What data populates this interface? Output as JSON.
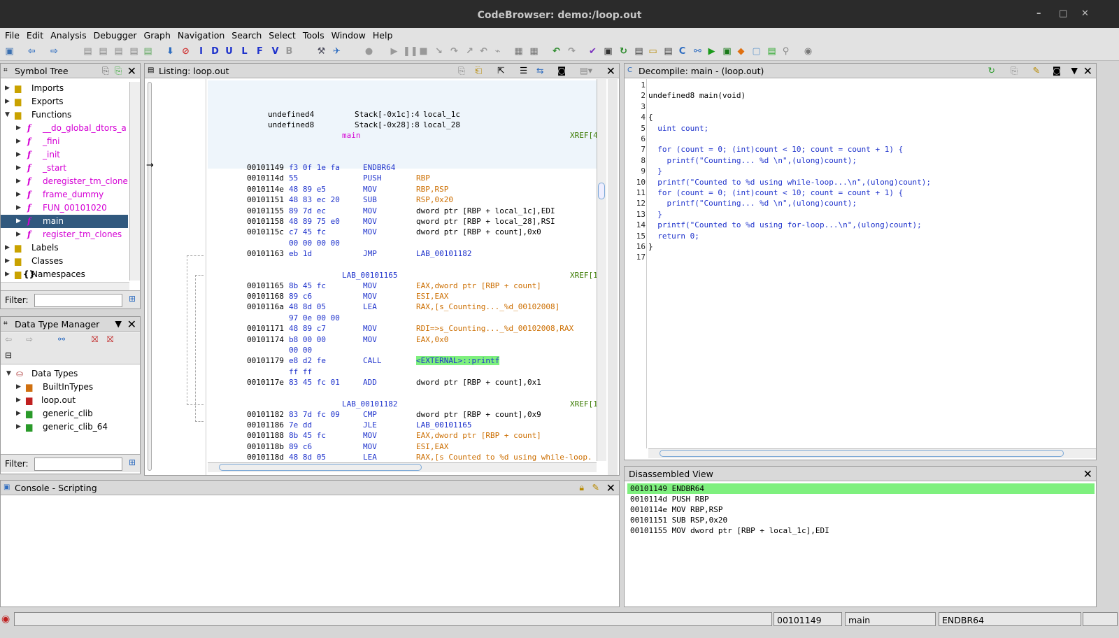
{
  "window": {
    "title": "CodeBrowser: demo:/loop.out",
    "controls": [
      "–",
      "□",
      "✕"
    ]
  },
  "menu": [
    "File",
    "Edit",
    "Analysis",
    "Debugger",
    "Graph",
    "Navigation",
    "Search",
    "Select",
    "Tools",
    "Window",
    "Help"
  ],
  "symbol_tree": {
    "title": "Symbol Tree",
    "items": [
      {
        "label": "Imports"
      },
      {
        "label": "Exports"
      },
      {
        "label": "Functions"
      },
      {
        "label": "__do_global_dtors_a"
      },
      {
        "label": "_fini"
      },
      {
        "label": "_init"
      },
      {
        "label": "_start"
      },
      {
        "label": "deregister_tm_clone"
      },
      {
        "label": "frame_dummy"
      },
      {
        "label": "FUN_00101020"
      },
      {
        "label": "main"
      },
      {
        "label": "register_tm_clones"
      },
      {
        "label": "Labels"
      },
      {
        "label": "Classes"
      },
      {
        "label": "Namespaces"
      }
    ],
    "filter_label": "Filter:"
  },
  "dtm": {
    "title": "Data Type Manager",
    "items": [
      {
        "label": "Data Types"
      },
      {
        "label": "BuiltInTypes"
      },
      {
        "label": "loop.out"
      },
      {
        "label": "generic_clib"
      },
      {
        "label": "generic_clib_64"
      }
    ],
    "filter_label": "Filter:"
  },
  "listing": {
    "title": "Listing:  loop.out",
    "header": [
      {
        "type": "undefined4",
        "stack": "Stack[-0x1c]:4",
        "name": "local_1c"
      },
      {
        "type": "undefined8",
        "stack": "Stack[-0x28]:8",
        "name": "local_28"
      }
    ],
    "func_label": "main",
    "xref": "XREF[4",
    "rows": [
      {
        "a": "00101149",
        "b": "f3 0f 1e fa",
        "m": "ENDBR64",
        "o": ""
      },
      {
        "a": "0010114d",
        "b": "55",
        "m": "PUSH",
        "o": "RBP"
      },
      {
        "a": "0010114e",
        "b": "48 89 e5",
        "m": "MOV",
        "o": "RBP,RSP"
      },
      {
        "a": "00101151",
        "b": "48 83 ec 20",
        "m": "SUB",
        "o": "RSP,0x20"
      },
      {
        "a": "00101155",
        "b": "89 7d ec",
        "m": "MOV",
        "o": "dword ptr [RBP + local_1c],EDI"
      },
      {
        "a": "00101158",
        "b": "48 89 75 e0",
        "m": "MOV",
        "o": "qword ptr [RBP + local_28],RSI"
      },
      {
        "a": "0010115c",
        "b": "c7 45 fc",
        "m": "MOV",
        "o": "dword ptr [RBP + count],0x0"
      },
      {
        "a": "",
        "b": "00 00 00 00",
        "m": "",
        "o": ""
      },
      {
        "a": "00101163",
        "b": "eb 1d",
        "m": "JMP",
        "o": "LAB_00101182"
      },
      {
        "a": "",
        "b": "",
        "m": "",
        "o": ""
      },
      {
        "a": "00101165",
        "b": "8b 45 fc",
        "m": "MOV",
        "o": "EAX,dword ptr [RBP + count]"
      },
      {
        "a": "00101168",
        "b": "89 c6",
        "m": "MOV",
        "o": "ESI,EAX"
      },
      {
        "a": "0010116a",
        "b": "48 8d 05",
        "m": "LEA",
        "o": "RAX,[s_Counting..._%d_00102008]"
      },
      {
        "a": "",
        "b": "97 0e 00 00",
        "m": "",
        "o": ""
      },
      {
        "a": "00101171",
        "b": "48 89 c7",
        "m": "MOV",
        "o": "RDI=>s_Counting..._%d_00102008,RAX"
      },
      {
        "a": "00101174",
        "b": "b8 00 00",
        "m": "MOV",
        "o": "EAX,0x0"
      },
      {
        "a": "",
        "b": "00 00",
        "m": "",
        "o": ""
      },
      {
        "a": "00101179",
        "b": "e8 d2 fe",
        "m": "CALL",
        "o": "<EXTERNAL>::printf"
      },
      {
        "a": "",
        "b": "ff ff",
        "m": "",
        "o": ""
      },
      {
        "a": "0010117e",
        "b": "83 45 fc 01",
        "m": "ADD",
        "o": "dword ptr [RBP + count],0x1"
      },
      {
        "a": "",
        "b": "",
        "m": "",
        "o": ""
      },
      {
        "a": "00101182",
        "b": "83 7d fc 09",
        "m": "CMP",
        "o": "dword ptr [RBP + count],0x9"
      },
      {
        "a": "00101186",
        "b": "7e dd",
        "m": "JLE",
        "o": "LAB_00101165"
      },
      {
        "a": "00101188",
        "b": "8b 45 fc",
        "m": "MOV",
        "o": "EAX,dword ptr [RBP + count]"
      },
      {
        "a": "0010118b",
        "b": "89 c6",
        "m": "MOV",
        "o": "ESI,EAX"
      },
      {
        "a": "0010118d",
        "b": "48 8d 05",
        "m": "LEA",
        "o": "RAX,[s_Counted_to_%d_using_while-loop."
      }
    ],
    "labels": [
      {
        "text": "LAB_00101165",
        "xref": "XREF[1"
      },
      {
        "text": "LAB_00101182",
        "xref": "XREF[1"
      }
    ]
  },
  "decompile": {
    "title": "Decompile: main -  (loop.out)",
    "lines": [
      "",
      "undefined8 main(void)",
      "",
      "{",
      "  uint count;",
      "",
      "  for (count = 0; (int)count < 10; count = count + 1) {",
      "    printf(\"Counting... %d \\n\",(ulong)count);",
      "  }",
      "  printf(\"Counted to %d using while-loop...\\n\",(ulong)count);",
      "  for (count = 0; (int)count < 10; count = count + 1) {",
      "    printf(\"Counting... %d \\n\",(ulong)count);",
      "  }",
      "  printf(\"Counted to %d using for-loop...\\n\",(ulong)count);",
      "  return 0;",
      "}",
      ""
    ]
  },
  "disassembled": {
    "title": "Disassembled View",
    "lines": [
      "00101149 ENDBR64",
      "0010114d PUSH RBP",
      "0010114e MOV RBP,RSP",
      "00101151 SUB RSP,0x20",
      "00101155 MOV dword ptr [RBP + local_1c],EDI"
    ]
  },
  "console": {
    "title": "Console - Scripting"
  },
  "status": {
    "address": "00101149",
    "function": "main",
    "instruction": "ENDBR64"
  },
  "colors": {
    "selection": "#31597e",
    "highlight": "#7ef07e",
    "symbol": "#d400d4",
    "keyword": "#1f33cc",
    "register": "#cc6e00"
  }
}
